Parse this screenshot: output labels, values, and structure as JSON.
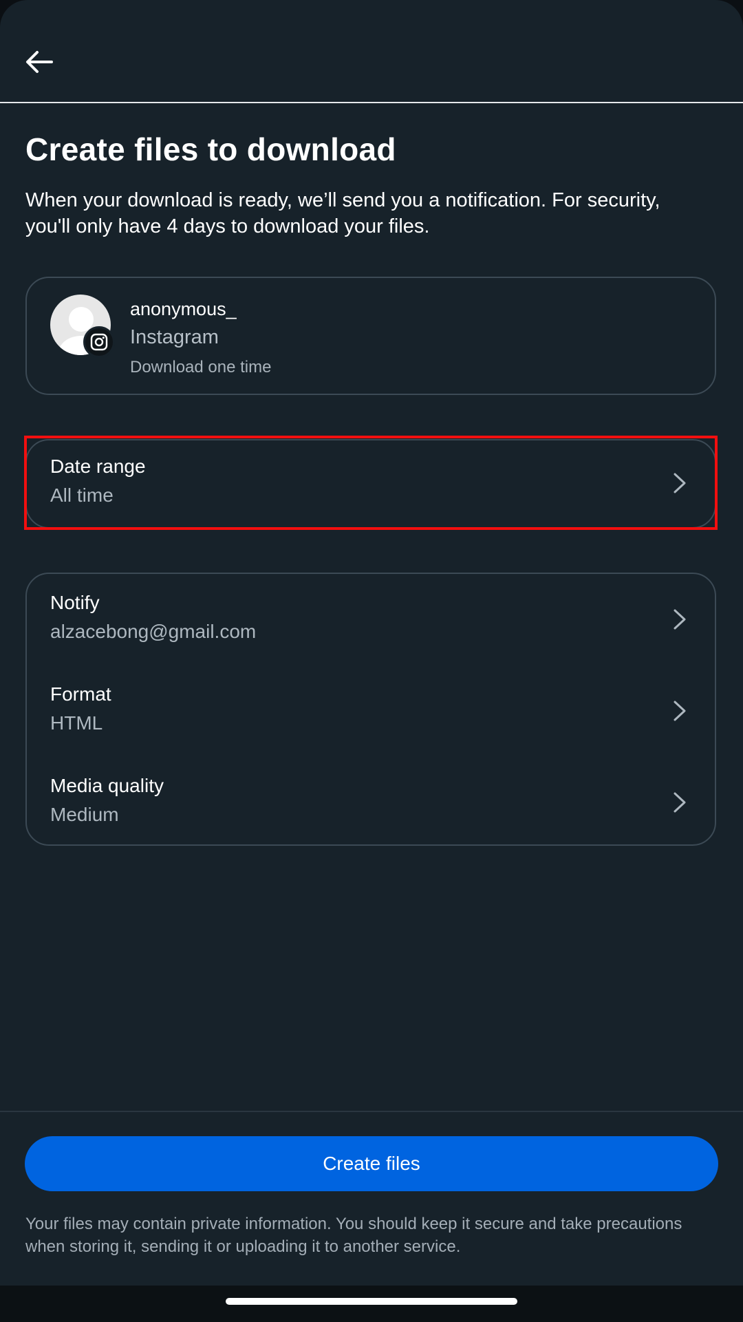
{
  "header": {
    "back_icon": "arrow-left-icon"
  },
  "page": {
    "title": "Create files to download",
    "description": "When your download is ready, we’ll send you a notification. For security, you'll only have 4 days to download your files."
  },
  "account": {
    "username": "anonymous_",
    "platform": "Instagram",
    "frequency": "Download one time",
    "avatar_icon": "default-avatar-icon",
    "badge_icon": "instagram-icon"
  },
  "date_range": {
    "label": "Date range",
    "value": "All time"
  },
  "settings": [
    {
      "label": "Notify",
      "value": "alzacebong@gmail.com"
    },
    {
      "label": "Format",
      "value": "HTML"
    },
    {
      "label": "Media quality",
      "value": "Medium"
    }
  ],
  "actions": {
    "create_label": "Create files"
  },
  "footer": {
    "disclaimer": "Your files may contain private information. You should keep it secure and take precautions when storing it, sending it or uploading it to another service."
  },
  "colors": {
    "background": "#17222a",
    "primary_button": "#0064e0",
    "highlight": "#f20f0f",
    "card_border": "#3c4a55",
    "secondary_text": "#aeb8c0"
  }
}
